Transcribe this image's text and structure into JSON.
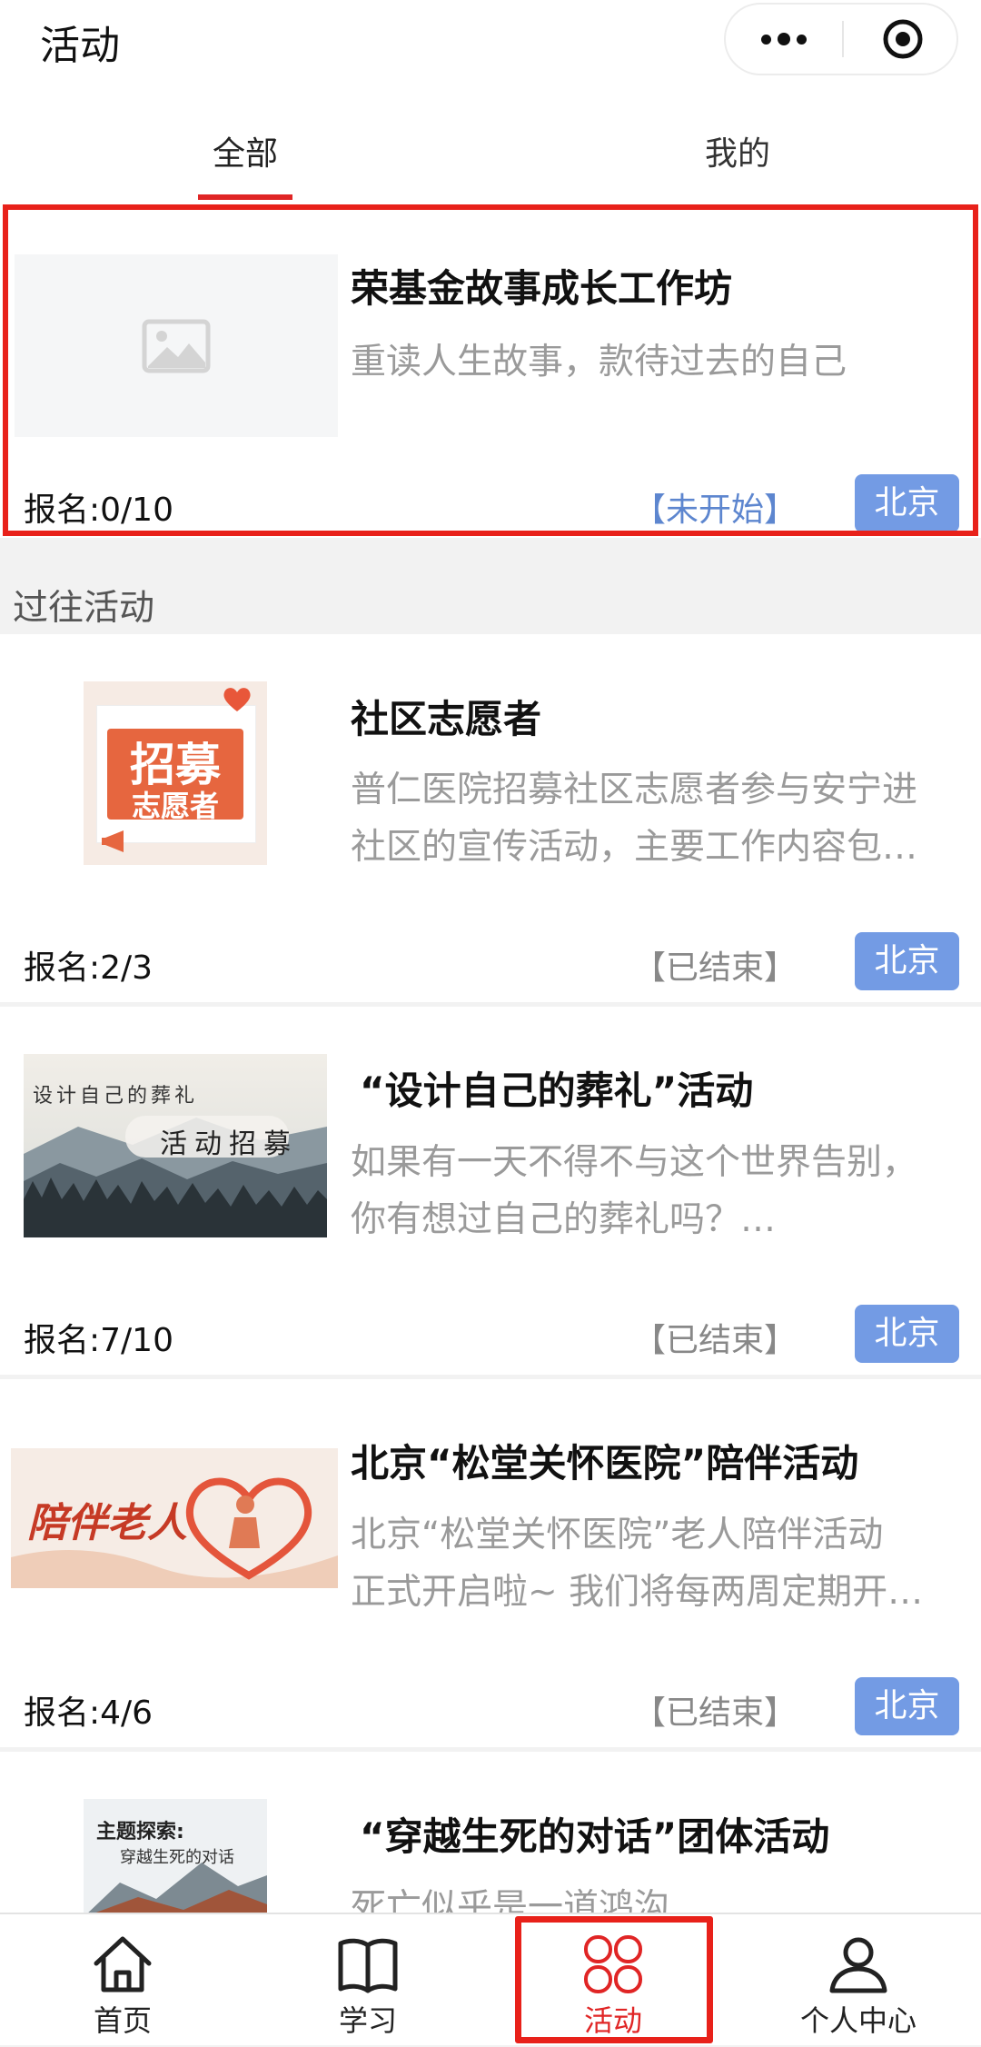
{
  "header": {
    "title": "活动"
  },
  "tabs": [
    {
      "label": "全部",
      "active": true
    },
    {
      "label": "我的",
      "active": false
    }
  ],
  "current_activity": {
    "title": "荣基金故事成长工作坊",
    "description": "重读人生故事，款待过去的自己",
    "signup": "报名:0/10",
    "status": "【未开始】",
    "city": "北京"
  },
  "past_section_label": "过往活动",
  "past_activities": [
    {
      "title": "社区志愿者",
      "description_lines": [
        "普仁医院招募社区志愿者参与安宁进",
        "社区的宣传活动，主要工作内容包…"
      ],
      "signup": "报名:2/3",
      "status": "【已结束】",
      "city": "北京",
      "image_text": [
        "招募",
        "志愿者"
      ]
    },
    {
      "title": "“设计自己的葬礼”活动",
      "description_lines": [
        "如果有一天不得不与这个世界告别，",
        "你有想过自己的葬礼吗？…"
      ],
      "signup": "报名:7/10",
      "status": "【已结束】",
      "city": "北京",
      "image_text": [
        "设计自己的葬礼",
        "活动招募"
      ]
    },
    {
      "title": "北京“松堂关怀医院”陪伴活动",
      "description_lines": [
        "北京“松堂关怀医院”老人陪伴活动",
        "正式开启啦~ 我们将每两周定期开…"
      ],
      "signup": "报名:4/6",
      "status": "【已结束】",
      "city": "北京",
      "image_text": [
        "陪伴老人"
      ]
    },
    {
      "title": "“穿越生死的对话”团体活动",
      "description_lines": [
        "死亡似乎是一道鸿沟"
      ],
      "image_text": [
        "主题探索:",
        "穿越生死的对话"
      ]
    }
  ],
  "bottom_nav": [
    {
      "label": "首页",
      "icon": "home-icon",
      "active": false
    },
    {
      "label": "学习",
      "icon": "book-icon",
      "active": false
    },
    {
      "label": "活动",
      "icon": "activity-clover-icon",
      "active": true
    },
    {
      "label": "个人中心",
      "icon": "person-icon",
      "active": false
    }
  ],
  "colors": {
    "accent_red": "#e02525",
    "city_badge": "#739be4",
    "status_upcoming": "#5d86cf"
  }
}
